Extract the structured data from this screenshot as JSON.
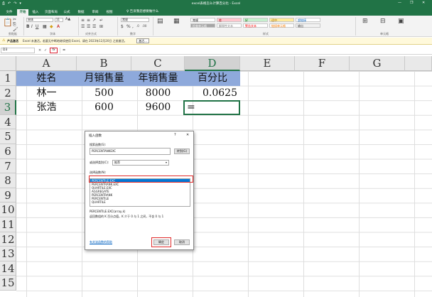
{
  "titlebar": {
    "title": "excel表格怎么计算百分比 - Excel",
    "quick_access": [
      "⎙",
      "↶",
      "↷",
      "▾"
    ],
    "controls": [
      "—",
      "❐",
      "✕"
    ]
  },
  "menu": {
    "tabs": [
      "文件",
      "开始",
      "插入",
      "页面布局",
      "公式",
      "数据",
      "审阅",
      "视图"
    ],
    "active_index": 1,
    "tell_me": "告诉我您想要做什么"
  },
  "ribbon": {
    "groups": [
      "剪贴板",
      "字体",
      "对齐方式",
      "数字",
      "样式",
      "单元格"
    ],
    "font_name": "宋体",
    "font_size": "11",
    "number_format": "常规",
    "styles": [
      {
        "label": "常规",
        "bg": "#ffffff",
        "fg": "#000000"
      },
      {
        "label": "差",
        "bg": "#ffc7ce",
        "fg": "#9c0006"
      },
      {
        "label": "好",
        "bg": "#c6efce",
        "fg": "#006100"
      },
      {
        "label": "适中",
        "bg": "#ffeb9c",
        "fg": "#9c6500"
      },
      {
        "label": "超链接",
        "bg": "#ffffff",
        "fg": "#0563c1"
      },
      {
        "label": "检查单元格",
        "bg": "#a5a5a5",
        "fg": "#ffffff"
      },
      {
        "label": "解释性文本",
        "bg": "#ffffff",
        "fg": "#7f7f7f"
      },
      {
        "label": "警告文本",
        "bg": "#ffffff",
        "fg": "#ff0000"
      },
      {
        "label": "链接单元格",
        "bg": "#ffffff",
        "fg": "#fa7d00"
      },
      {
        "label": "输出",
        "bg": "#f2f2f2",
        "fg": "#3f3f3f"
      }
    ]
  },
  "message_bar": {
    "title": "产品激活",
    "text": "Excel 未激活。若要无中断地继续使用 Excel，请在 2023年12月20日 之前激活。",
    "button": "激活..."
  },
  "formula_bar": {
    "name_box": "D3",
    "cancel": "✕",
    "enter": "✓",
    "fx": "fx",
    "content": "="
  },
  "grid": {
    "columns": [
      "A",
      "B",
      "C",
      "D",
      "E",
      "F",
      "G"
    ],
    "selected_column": "D",
    "rows": [
      "1",
      "2",
      "3",
      "4",
      "5",
      "6",
      "7",
      "8",
      "9",
      "10",
      "11",
      "12",
      "13",
      "14",
      "15"
    ],
    "selected_row": "3",
    "header_fill": "#8ea9db",
    "cells": {
      "A1": "姓名",
      "B1": "月销售量",
      "C1": "年销售量",
      "D1": "百分比",
      "A2": "林一",
      "B2": "500",
      "C2": "8000",
      "D2": "0.0625",
      "A3": "张浩",
      "B3": "600",
      "C3": "9600",
      "D3": "="
    }
  },
  "dialog": {
    "title": "插入函数",
    "help": "?",
    "close": "✕",
    "search_label": "搜索函数(S):",
    "search_value": "PERCENTANKEXC",
    "go_button": "转到(G)",
    "category_label": "或选择类别(C):",
    "category_value": "推荐",
    "select_label": "选择函数(N):",
    "functions": [
      "PERCENTILE.EXC",
      "PERCENTRANK.EXC",
      "QUARTILE.EXC",
      "AGGREGATE",
      "PERCENTRANK",
      "PERCENTILE",
      "QUARTILE"
    ],
    "selected_index": 0,
    "signature": "PERCENTILE.EXC(array,k)",
    "description": "返回数组的 K 百分点值，K 介于 0 与 1 之间，不含 0 与 1",
    "help_link": "有关该函数的帮助",
    "ok": "确定",
    "cancel": "取消"
  }
}
